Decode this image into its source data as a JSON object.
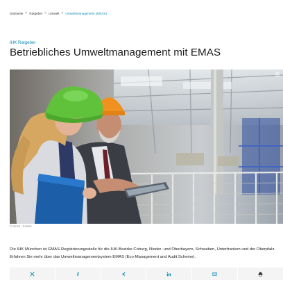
{
  "breadcrumb": {
    "items": [
      "Startseite",
      "Ratgeber",
      "Umwelt"
    ],
    "current": "Umweltmanagement (EMAS)",
    "separator": ">"
  },
  "article": {
    "kicker": "IHK Ratgeber",
    "title": "Betriebliches Umweltmanagement mit EMAS",
    "image_credit": "© istock - Kemaii",
    "intro": "Die IHK München ist EMAS-Registrierungsstelle für die IHK-Bezirke Coburg, Nieder- und Oberbayern, Schwaben, Unterfranken und der Oberpfalz. Erfahren Sie mehr über das Umweltmanagementsystem EMAS (Eco-Management and Audit Scheme)."
  },
  "share": {
    "buttons": [
      "x-icon",
      "facebook-icon",
      "xing-icon",
      "linkedin-icon",
      "mail-icon",
      "print-icon"
    ],
    "icon_color": "#0a8ab8"
  },
  "colors": {
    "accent": "#0a8ab8",
    "helmet_green": "#5fc23a",
    "helmet_orange": "#f0901f",
    "folder_blue": "#1c5fa8"
  }
}
